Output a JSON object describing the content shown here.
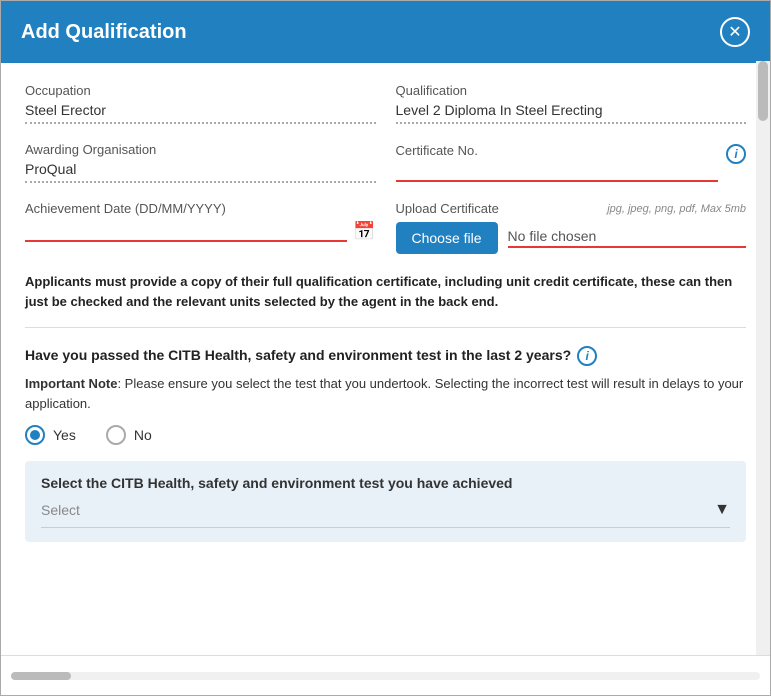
{
  "header": {
    "title": "Add Qualification",
    "close_label": "✕"
  },
  "form": {
    "occupation_label": "Occupation",
    "occupation_value": "Steel Erector",
    "qualification_label": "Qualification",
    "qualification_value": "Level 2 Diploma In Steel Erecting",
    "awarding_org_label": "Awarding Organisation",
    "awarding_org_value": "ProQual",
    "cert_no_label": "Certificate No.",
    "cert_no_placeholder": "",
    "upload_label": "Upload Certificate",
    "upload_hint": "jpg, jpeg, png, pdf, Max 5mb",
    "choose_file_btn": "Choose file",
    "no_file_text": "No file chosen",
    "achievement_date_label": "Achievement Date (DD/MM/YYYY)",
    "achievement_date_placeholder": ""
  },
  "notice": {
    "text": "Applicants must provide a copy of their full qualification certificate, including unit credit certificate, these can then just be checked and the relevant units selected by the agent in the back end."
  },
  "question": {
    "text": "Have you passed the CITB Health, safety and environment test in the last 2 years?",
    "important_label": "Important Note",
    "important_text": ": Please ensure you select the test that you undertook. Selecting the incorrect test will result in delays to your application.",
    "yes_label": "Yes",
    "no_label": "No"
  },
  "citb_box": {
    "title": "Select the CITB Health, safety and environment test you have achieved",
    "select_placeholder": "Select"
  }
}
